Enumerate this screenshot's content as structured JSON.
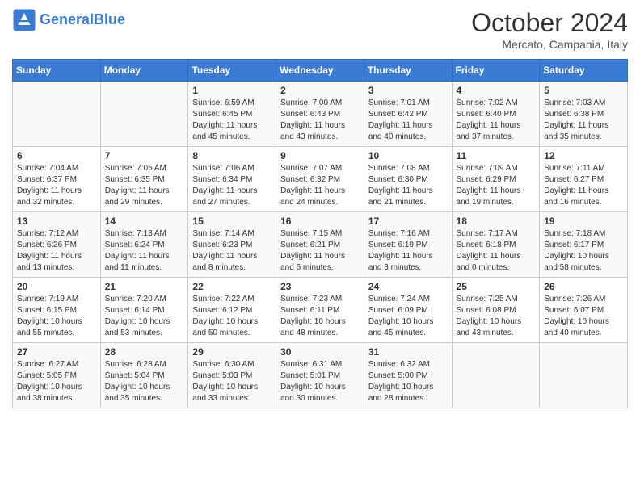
{
  "header": {
    "logo_general": "General",
    "logo_blue": "Blue",
    "month": "October 2024",
    "location": "Mercato, Campania, Italy"
  },
  "days_of_week": [
    "Sunday",
    "Monday",
    "Tuesday",
    "Wednesday",
    "Thursday",
    "Friday",
    "Saturday"
  ],
  "weeks": [
    [
      {
        "day": "",
        "sunrise": "",
        "sunset": "",
        "daylight": ""
      },
      {
        "day": "",
        "sunrise": "",
        "sunset": "",
        "daylight": ""
      },
      {
        "day": "1",
        "sunrise": "Sunrise: 6:59 AM",
        "sunset": "Sunset: 6:45 PM",
        "daylight": "Daylight: 11 hours and 45 minutes."
      },
      {
        "day": "2",
        "sunrise": "Sunrise: 7:00 AM",
        "sunset": "Sunset: 6:43 PM",
        "daylight": "Daylight: 11 hours and 43 minutes."
      },
      {
        "day": "3",
        "sunrise": "Sunrise: 7:01 AM",
        "sunset": "Sunset: 6:42 PM",
        "daylight": "Daylight: 11 hours and 40 minutes."
      },
      {
        "day": "4",
        "sunrise": "Sunrise: 7:02 AM",
        "sunset": "Sunset: 6:40 PM",
        "daylight": "Daylight: 11 hours and 37 minutes."
      },
      {
        "day": "5",
        "sunrise": "Sunrise: 7:03 AM",
        "sunset": "Sunset: 6:38 PM",
        "daylight": "Daylight: 11 hours and 35 minutes."
      }
    ],
    [
      {
        "day": "6",
        "sunrise": "Sunrise: 7:04 AM",
        "sunset": "Sunset: 6:37 PM",
        "daylight": "Daylight: 11 hours and 32 minutes."
      },
      {
        "day": "7",
        "sunrise": "Sunrise: 7:05 AM",
        "sunset": "Sunset: 6:35 PM",
        "daylight": "Daylight: 11 hours and 29 minutes."
      },
      {
        "day": "8",
        "sunrise": "Sunrise: 7:06 AM",
        "sunset": "Sunset: 6:34 PM",
        "daylight": "Daylight: 11 hours and 27 minutes."
      },
      {
        "day": "9",
        "sunrise": "Sunrise: 7:07 AM",
        "sunset": "Sunset: 6:32 PM",
        "daylight": "Daylight: 11 hours and 24 minutes."
      },
      {
        "day": "10",
        "sunrise": "Sunrise: 7:08 AM",
        "sunset": "Sunset: 6:30 PM",
        "daylight": "Daylight: 11 hours and 21 minutes."
      },
      {
        "day": "11",
        "sunrise": "Sunrise: 7:09 AM",
        "sunset": "Sunset: 6:29 PM",
        "daylight": "Daylight: 11 hours and 19 minutes."
      },
      {
        "day": "12",
        "sunrise": "Sunrise: 7:11 AM",
        "sunset": "Sunset: 6:27 PM",
        "daylight": "Daylight: 11 hours and 16 minutes."
      }
    ],
    [
      {
        "day": "13",
        "sunrise": "Sunrise: 7:12 AM",
        "sunset": "Sunset: 6:26 PM",
        "daylight": "Daylight: 11 hours and 13 minutes."
      },
      {
        "day": "14",
        "sunrise": "Sunrise: 7:13 AM",
        "sunset": "Sunset: 6:24 PM",
        "daylight": "Daylight: 11 hours and 11 minutes."
      },
      {
        "day": "15",
        "sunrise": "Sunrise: 7:14 AM",
        "sunset": "Sunset: 6:23 PM",
        "daylight": "Daylight: 11 hours and 8 minutes."
      },
      {
        "day": "16",
        "sunrise": "Sunrise: 7:15 AM",
        "sunset": "Sunset: 6:21 PM",
        "daylight": "Daylight: 11 hours and 6 minutes."
      },
      {
        "day": "17",
        "sunrise": "Sunrise: 7:16 AM",
        "sunset": "Sunset: 6:19 PM",
        "daylight": "Daylight: 11 hours and 3 minutes."
      },
      {
        "day": "18",
        "sunrise": "Sunrise: 7:17 AM",
        "sunset": "Sunset: 6:18 PM",
        "daylight": "Daylight: 11 hours and 0 minutes."
      },
      {
        "day": "19",
        "sunrise": "Sunrise: 7:18 AM",
        "sunset": "Sunset: 6:17 PM",
        "daylight": "Daylight: 10 hours and 58 minutes."
      }
    ],
    [
      {
        "day": "20",
        "sunrise": "Sunrise: 7:19 AM",
        "sunset": "Sunset: 6:15 PM",
        "daylight": "Daylight: 10 hours and 55 minutes."
      },
      {
        "day": "21",
        "sunrise": "Sunrise: 7:20 AM",
        "sunset": "Sunset: 6:14 PM",
        "daylight": "Daylight: 10 hours and 53 minutes."
      },
      {
        "day": "22",
        "sunrise": "Sunrise: 7:22 AM",
        "sunset": "Sunset: 6:12 PM",
        "daylight": "Daylight: 10 hours and 50 minutes."
      },
      {
        "day": "23",
        "sunrise": "Sunrise: 7:23 AM",
        "sunset": "Sunset: 6:11 PM",
        "daylight": "Daylight: 10 hours and 48 minutes."
      },
      {
        "day": "24",
        "sunrise": "Sunrise: 7:24 AM",
        "sunset": "Sunset: 6:09 PM",
        "daylight": "Daylight: 10 hours and 45 minutes."
      },
      {
        "day": "25",
        "sunrise": "Sunrise: 7:25 AM",
        "sunset": "Sunset: 6:08 PM",
        "daylight": "Daylight: 10 hours and 43 minutes."
      },
      {
        "day": "26",
        "sunrise": "Sunrise: 7:26 AM",
        "sunset": "Sunset: 6:07 PM",
        "daylight": "Daylight: 10 hours and 40 minutes."
      }
    ],
    [
      {
        "day": "27",
        "sunrise": "Sunrise: 6:27 AM",
        "sunset": "Sunset: 5:05 PM",
        "daylight": "Daylight: 10 hours and 38 minutes."
      },
      {
        "day": "28",
        "sunrise": "Sunrise: 6:28 AM",
        "sunset": "Sunset: 5:04 PM",
        "daylight": "Daylight: 10 hours and 35 minutes."
      },
      {
        "day": "29",
        "sunrise": "Sunrise: 6:30 AM",
        "sunset": "Sunset: 5:03 PM",
        "daylight": "Daylight: 10 hours and 33 minutes."
      },
      {
        "day": "30",
        "sunrise": "Sunrise: 6:31 AM",
        "sunset": "Sunset: 5:01 PM",
        "daylight": "Daylight: 10 hours and 30 minutes."
      },
      {
        "day": "31",
        "sunrise": "Sunrise: 6:32 AM",
        "sunset": "Sunset: 5:00 PM",
        "daylight": "Daylight: 10 hours and 28 minutes."
      },
      {
        "day": "",
        "sunrise": "",
        "sunset": "",
        "daylight": ""
      },
      {
        "day": "",
        "sunrise": "",
        "sunset": "",
        "daylight": ""
      }
    ]
  ]
}
